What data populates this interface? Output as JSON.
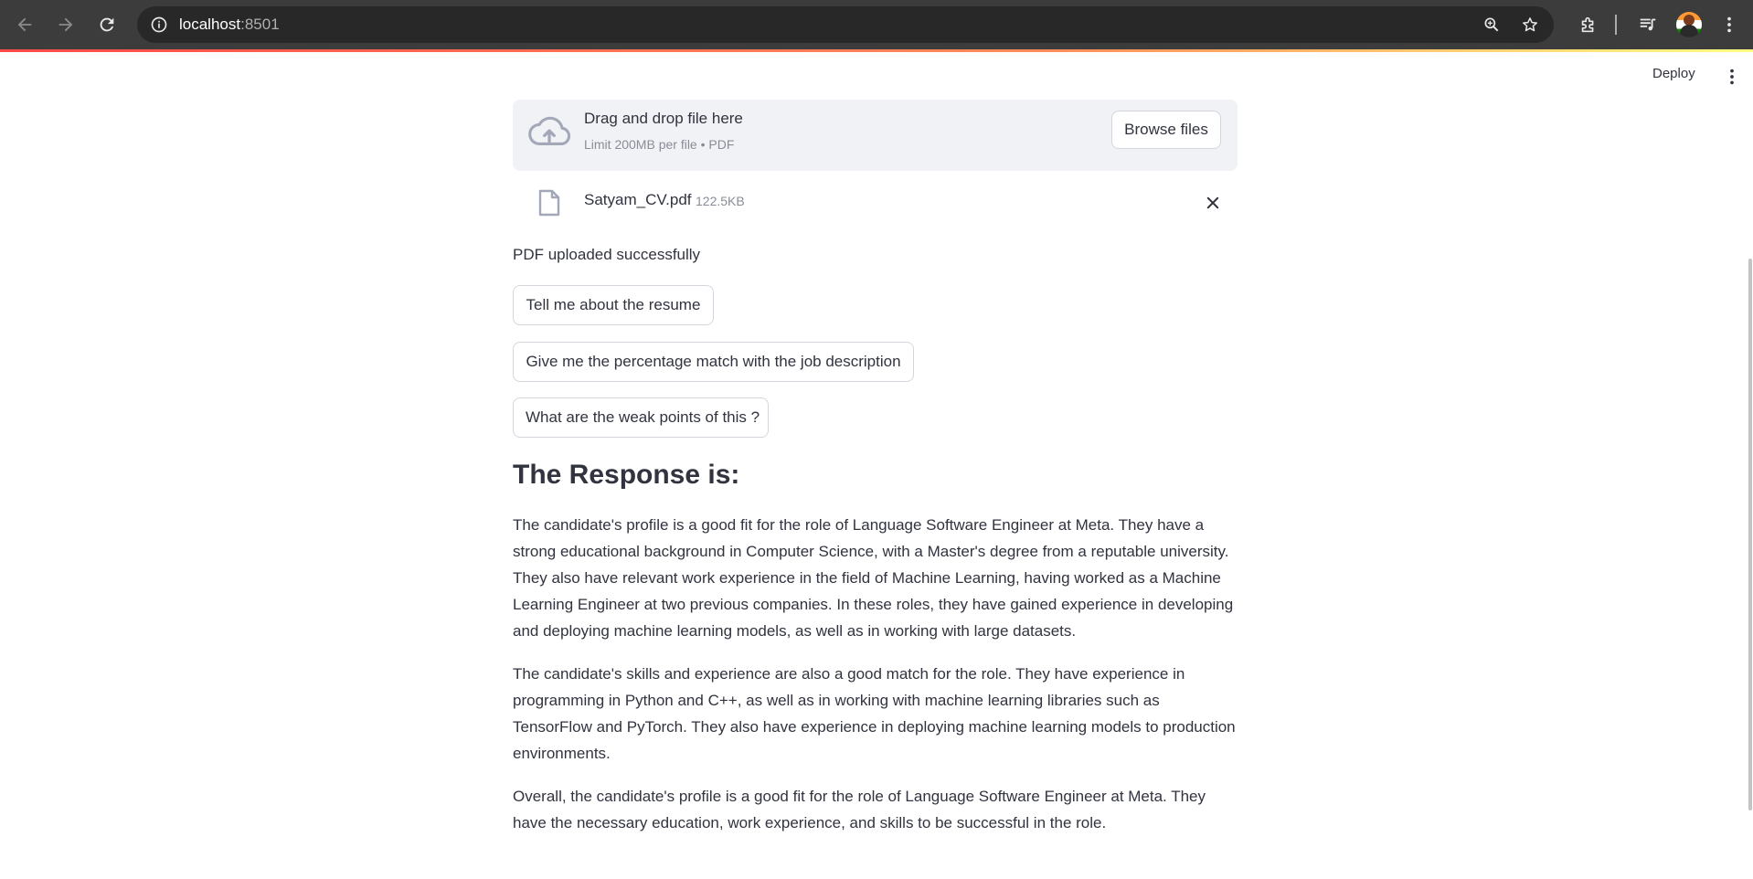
{
  "browser": {
    "url_host": "localhost",
    "url_port": ":8501",
    "icons": [
      "back-arrow-icon",
      "forward-arrow-icon",
      "reload-icon",
      "site-info-icon",
      "zoom-icon",
      "bookmark-star-icon",
      "extensions-icon",
      "media-control-icon",
      "profile-avatar",
      "chrome-menu-icon"
    ]
  },
  "header": {
    "deploy_label": "Deploy"
  },
  "uploader": {
    "title": "Drag and drop file here",
    "limit": "Limit 200MB per file • PDF",
    "browse_label": "Browse files",
    "file": {
      "name": "Satyam_CV.pdf",
      "size": "122.5KB"
    }
  },
  "status_text": "PDF uploaded successfully",
  "buttons": [
    {
      "label": "Tell me about the resume"
    },
    {
      "label": "Give me the percentage match with the job description"
    },
    {
      "label": "What are the weak points of this ?"
    }
  ],
  "response": {
    "heading": "The Response is:",
    "paragraphs": [
      "The candidate's profile is a good fit for the role of Language Software Engineer at Meta. They have a strong educational background in Computer Science, with a Master's degree from a reputable university. They also have relevant work experience in the field of Machine Learning, having worked as a Machine Learning Engineer at two previous companies. In these roles, they have gained experience in developing and deploying machine learning models, as well as in working with large datasets.",
      "The candidate's skills and experience are also a good match for the role. They have experience in programming in Python and C++, as well as in working with machine learning libraries such as TensorFlow and PyTorch. They also have experience in deploying machine learning models to production environments.",
      "Overall, the candidate's profile is a good fit for the role of Language Software Engineer at Meta. They have the necessary education, work experience, and skills to be successful in the role."
    ]
  },
  "colors": {
    "chrome_bg": "#3c3c3c",
    "omnibox_bg": "#282828",
    "dropzone_bg": "#f0f2f6",
    "text": "#31333f",
    "muted_text": "#8a8d97",
    "accent_red": "#ff4b4b"
  }
}
